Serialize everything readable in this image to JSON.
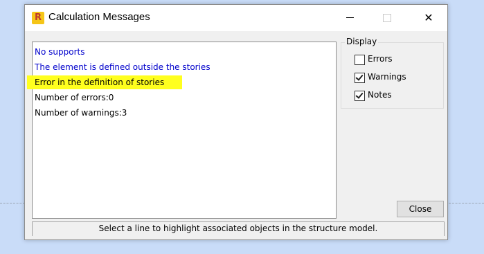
{
  "window": {
    "title": "Calculation Messages",
    "app_icon_glyph": "R",
    "minimize_icon": "minimize-icon",
    "maximize_icon": "maximize-icon",
    "close_glyph": "✕"
  },
  "messages": [
    {
      "text": "No supports",
      "color": "#0000cc",
      "highlighted": false
    },
    {
      "text": "The element is defined outside the stories",
      "color": "#0000cc",
      "highlighted": false
    },
    {
      "text": "Error in the definition of stories",
      "color": "#000000",
      "highlighted": true
    },
    {
      "text": "Number of errors:0",
      "color": "#000000",
      "highlighted": false
    },
    {
      "text": "Number of warnings:3",
      "color": "#000000",
      "highlighted": false
    }
  ],
  "display": {
    "label": "Display",
    "options": [
      {
        "label": "Errors",
        "checked": false
      },
      {
        "label": "Warnings",
        "checked": true
      },
      {
        "label": "Notes",
        "checked": true
      }
    ]
  },
  "buttons": {
    "close_label": "Close"
  },
  "status": {
    "text": "Select a line to highlight associated objects in the structure model."
  },
  "colors": {
    "highlight": "#ffff1e",
    "message_blue": "#0000cc",
    "background": "#c9dcf8"
  }
}
